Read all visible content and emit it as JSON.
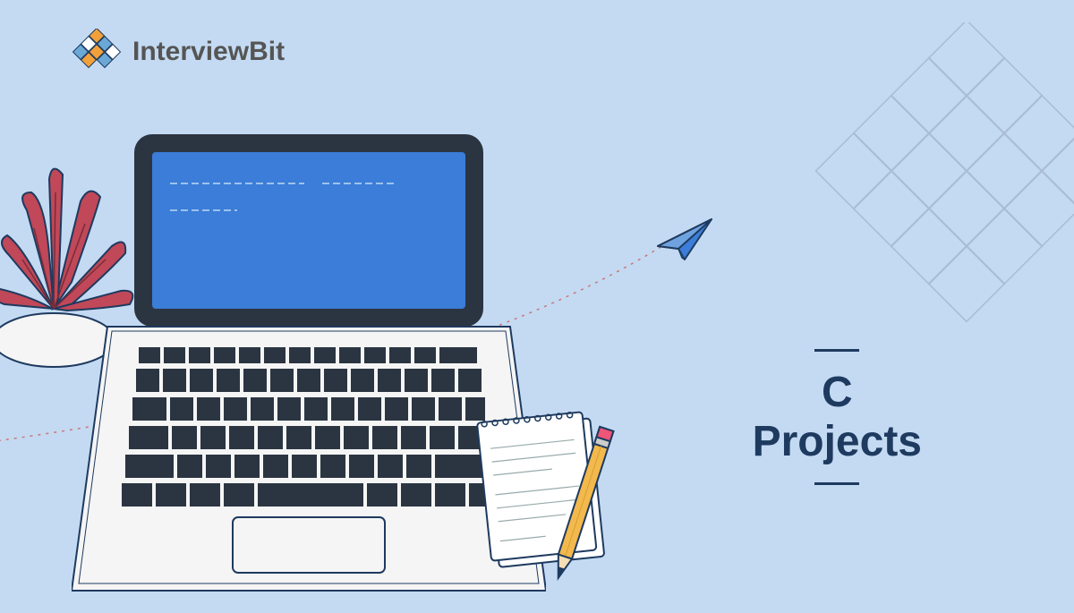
{
  "brand": {
    "name_part1": "Interview",
    "name_part2": "Bit"
  },
  "title": {
    "line1": "C",
    "line2": "Projects"
  },
  "colors": {
    "bg": "#c3daf2",
    "dark": "#1e3a5f",
    "screen": "#3b7dd8",
    "laptop_body": "#f5f5f5",
    "laptop_bezel": "#2b3542",
    "plant_red": "#c04858",
    "pencil_yellow": "#f3b94c",
    "logo_orange": "#f2a03a",
    "logo_blue": "#6ba8d6"
  },
  "icons": {
    "logo": "logo-diamonds-icon",
    "plane": "paper-plane-icon",
    "plant": "plant-icon",
    "laptop": "laptop-icon",
    "notepad": "notepad-icon",
    "pencil": "pencil-icon",
    "grid": "diamond-grid-icon"
  }
}
